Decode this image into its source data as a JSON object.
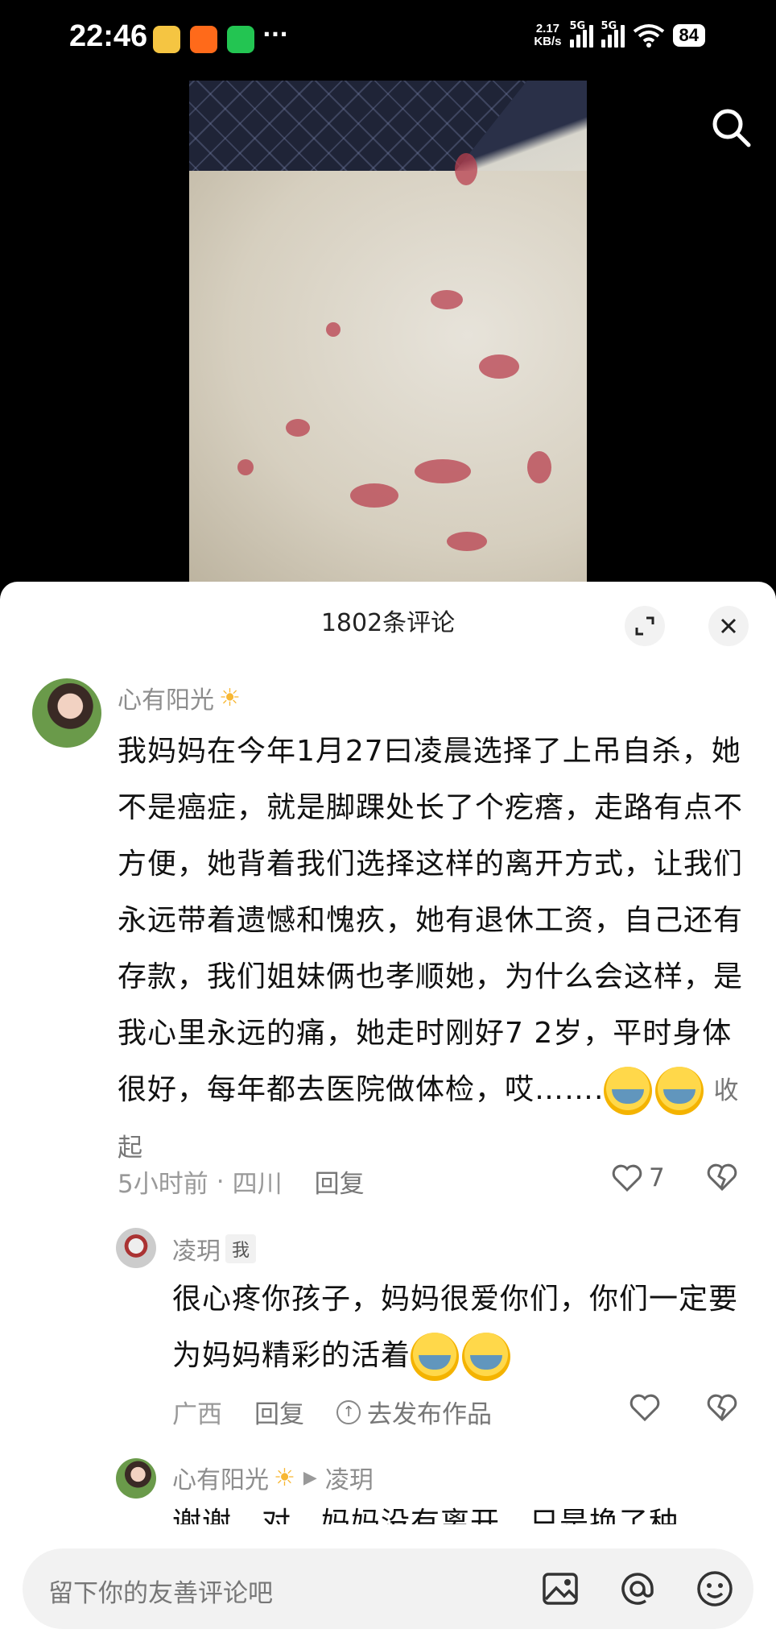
{
  "status_bar": {
    "time": "22:46",
    "net_speed_value": "2.17",
    "net_speed_unit": "KB/s",
    "signal_1_label": "5G",
    "signal_2_label": "5G",
    "battery": "84",
    "more": "···"
  },
  "sheet": {
    "title": "1802条评论"
  },
  "comments": [
    {
      "username": "心有阳光",
      "text": "我妈妈在今年1月27曰凌晨选择了上吊自杀，她不是癌症，就是脚踝处长了个疙瘩，走路有点不方便，她背着我们选择这样的离开方式，让我们永远带着遗憾和愧疚，她有退休工资，自己还有存款，我们姐妹俩也孝顺她，为什么会这样，是我心里永远的痛，她走时刚好7 2岁，平时身体很好，每年都去医院做体检，哎…….",
      "collapse_label": "收起",
      "time": "5小时前",
      "location": "四川",
      "reply_label": "回复",
      "likes": "7"
    },
    {
      "username": "凌玥",
      "badge": "我",
      "text": "很心疼你孩子，妈妈很爱你们，你们一定要为妈妈精彩的活着",
      "location": "广西",
      "reply_label": "回复",
      "publish_label": "去发布作品"
    },
    {
      "username": "心有阳光",
      "reply_to": "凌玥",
      "text": "谢谢，对，妈妈没有离开，只是换了种"
    }
  ],
  "input": {
    "placeholder": "留下你的友善评论吧"
  },
  "icons": [
    "search-icon",
    "expand-icon",
    "close-icon",
    "heart-icon",
    "broken-heart-icon",
    "image-icon",
    "at-icon",
    "emoji-icon",
    "sun-emoji",
    "crying-emoji"
  ]
}
